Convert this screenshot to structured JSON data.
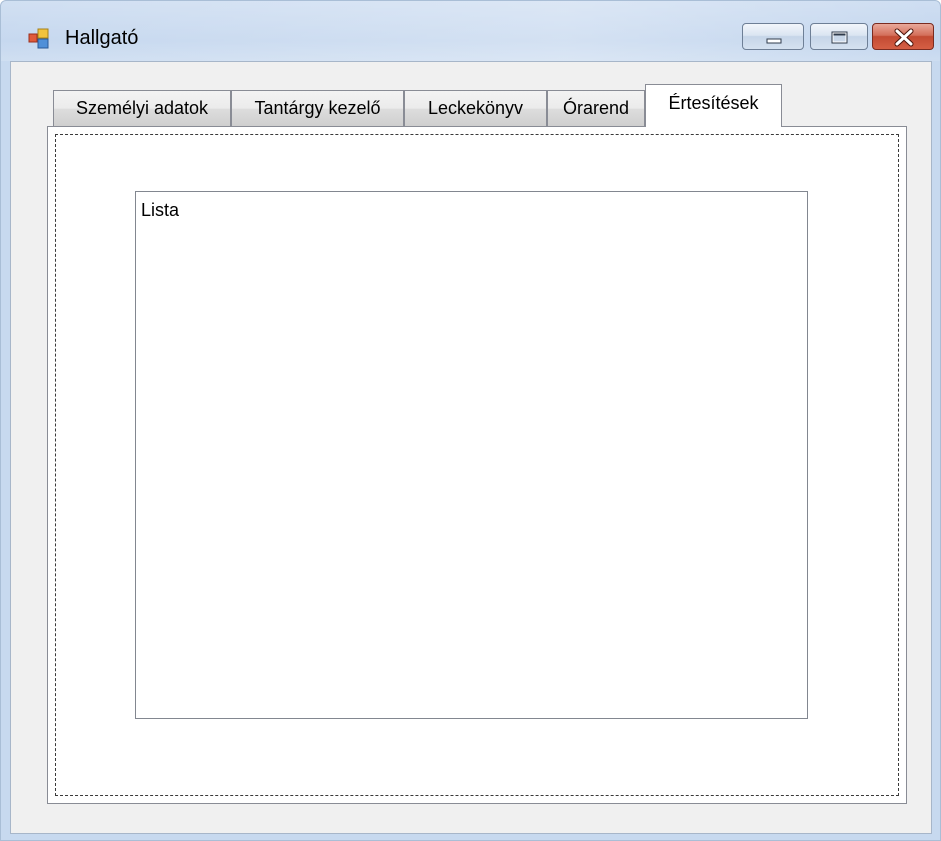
{
  "window": {
    "title": "Hallgató",
    "icon": "app-window-icon",
    "controls": {
      "minimize_icon": "minimize-icon",
      "maximize_icon": "maximize-icon",
      "close_icon": "close-icon"
    }
  },
  "tabs": [
    {
      "label": "Személyi adatok",
      "active": false
    },
    {
      "label": "Tantárgy kezelő",
      "active": false
    },
    {
      "label": "Leckekönyv",
      "active": false
    },
    {
      "label": "Órarend",
      "active": false
    },
    {
      "label": "Értesítések",
      "active": true
    }
  ],
  "notifications_panel": {
    "list": {
      "items": [
        "Lista"
      ]
    }
  },
  "colors": {
    "frame": "#c7d9ef",
    "client_background": "#f0f0f0",
    "close_button": "#c24a33"
  }
}
